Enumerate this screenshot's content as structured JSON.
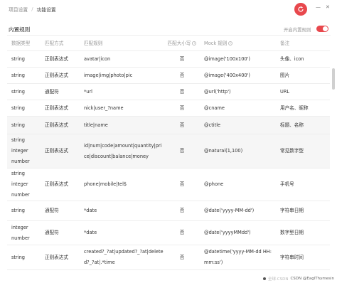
{
  "breadcrumb": {
    "parent": "项目设置",
    "separator": "/",
    "current": "功能设置"
  },
  "section": {
    "title": "内置规则",
    "toggle_label": "开启内置规则",
    "toggle_on": true
  },
  "table": {
    "headers": [
      "数据类型",
      "匹配方式",
      "匹配规则",
      "匹配大小写",
      "Mock 规则",
      "备注"
    ],
    "rows": [
      {
        "type": [
          "string"
        ],
        "match": "正则表达式",
        "rule": "avatar|icon",
        "case": "否",
        "mock": "@image('100x100')",
        "note": "头像、icon"
      },
      {
        "type": [
          "string"
        ],
        "match": "正则表达式",
        "rule": "image|img|photo|pic",
        "case": "否",
        "mock": "@image('400x400')",
        "note": "图片"
      },
      {
        "type": [
          "string"
        ],
        "match": "通配符",
        "rule": "*url",
        "case": "否",
        "mock": "@url('http')",
        "note": "URL"
      },
      {
        "type": [
          "string"
        ],
        "match": "正则表达式",
        "rule": "nick|user_?name",
        "case": "否",
        "mock": "@cname",
        "note": "用户名、昵称"
      },
      {
        "type": [
          "string"
        ],
        "match": "正则表达式",
        "rule": "title|name",
        "case": "否",
        "mock": "@ctitle",
        "note": "标题、名称"
      },
      {
        "type": [
          "string",
          "integer",
          "number"
        ],
        "match": "正则表达式",
        "rule": "id|num|code|amount|quantity|price|discount|balance|money",
        "case": "否",
        "mock": "@natural(1,100)",
        "note": "常见数字型"
      },
      {
        "type": [
          "string",
          "integer",
          "number"
        ],
        "match": "正则表达式",
        "rule": "phone|mobile|tel$",
        "case": "否",
        "mock": "@phone",
        "note": "手机号"
      },
      {
        "type": [
          "string"
        ],
        "match": "通配符",
        "rule": "*date",
        "case": "否",
        "mock": "@date('yyyy-MM-dd')",
        "note": "字符串日期"
      },
      {
        "type": [
          "integer",
          "number"
        ],
        "match": "通配符",
        "rule": "*date",
        "case": "否",
        "mock": "@date('yyyyMMdd')",
        "note": "数字型日期"
      },
      {
        "type": [
          "string"
        ],
        "match": "正则表达式",
        "rule": "created?_?at|updated?_?at|deleted?_?at|.*time",
        "case": "否",
        "mock": "@datetime('yyyy-MM-dd HH:mm:ss')",
        "note": "字符串时间"
      }
    ]
  },
  "watermark": {
    "prefix": "全球·CSDN",
    "text": "CSDN @EaglThymesin"
  },
  "colors": {
    "accent": "#e8484d",
    "stripe": "#f6f6f6",
    "header_text": "#999999"
  },
  "icons": {
    "refresh": "refresh-icon",
    "minimize": "minimize-icon",
    "close": "close-icon",
    "info": "info-icon"
  }
}
